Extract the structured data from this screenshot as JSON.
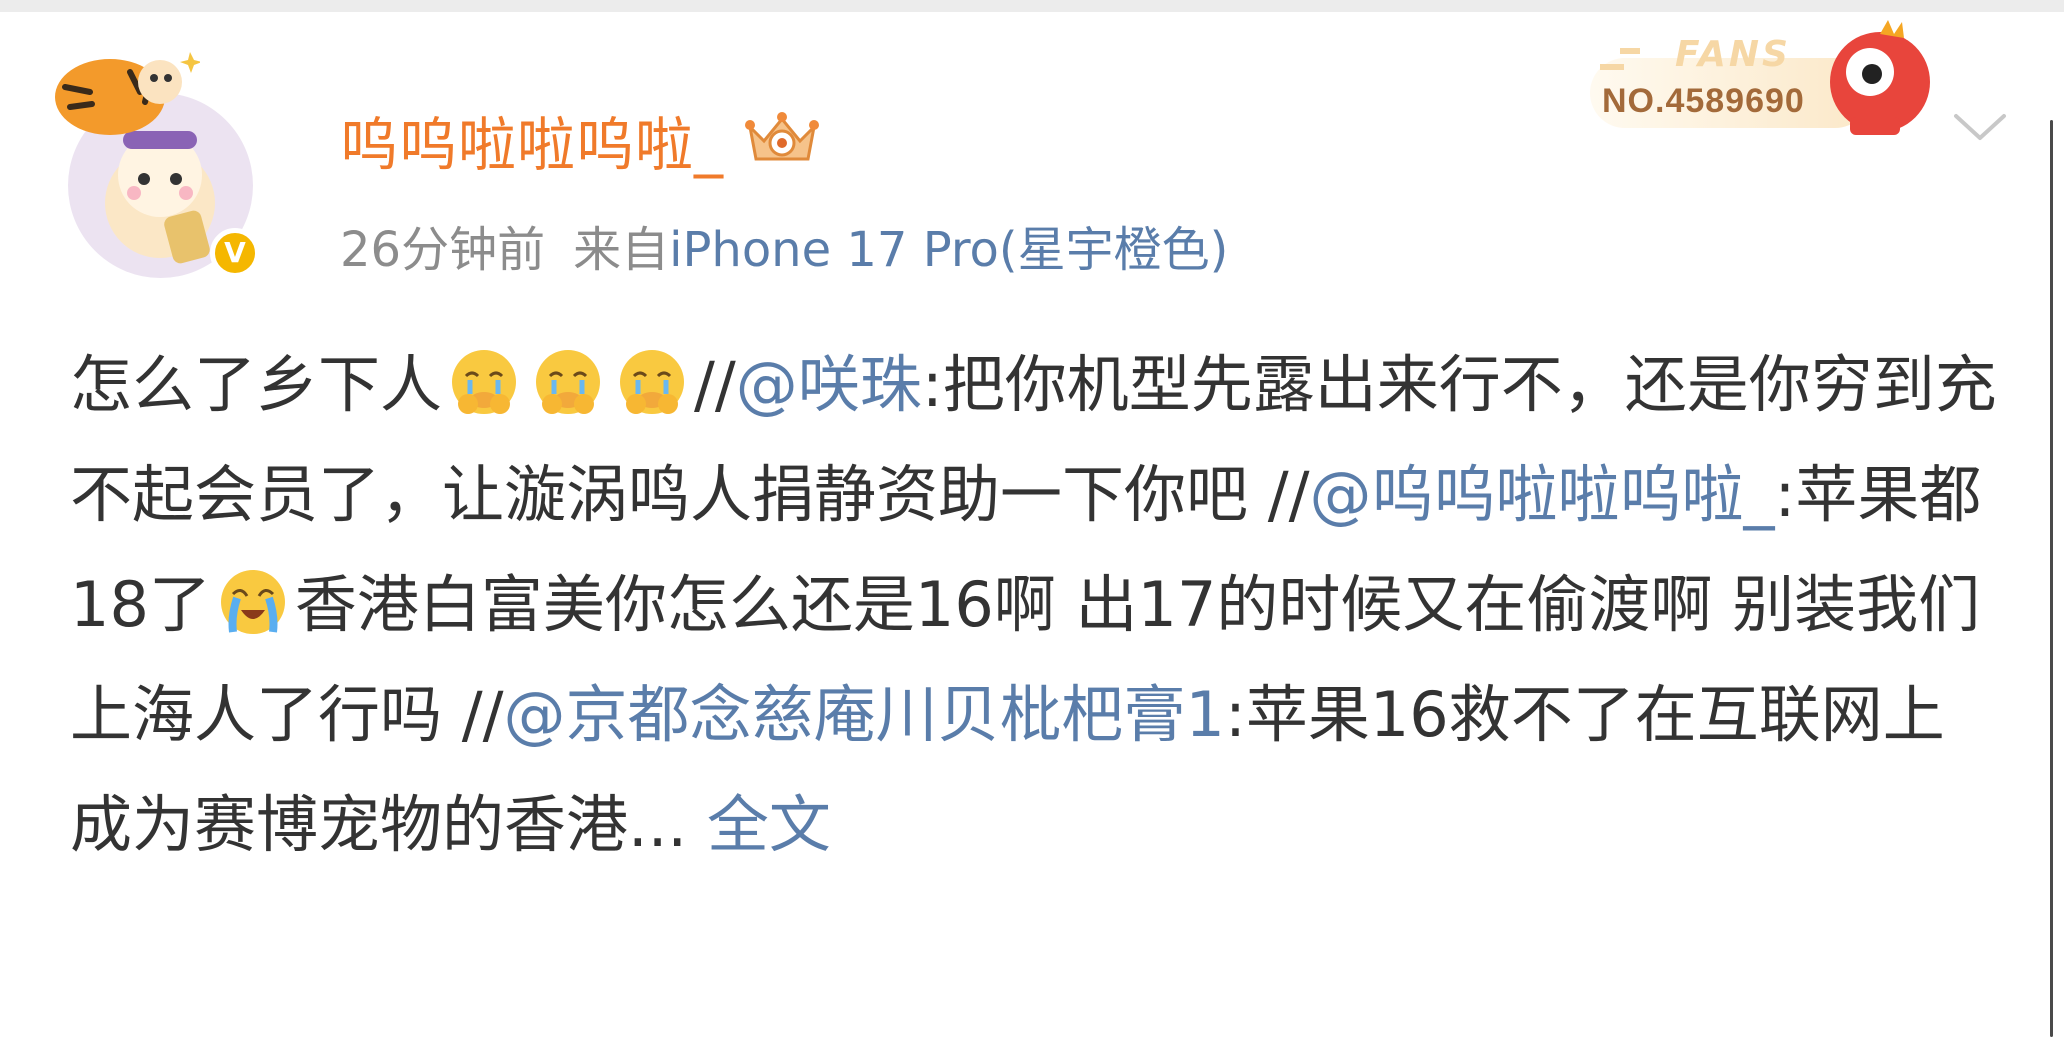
{
  "post": {
    "author": {
      "name": "呜呜啦啦呜啦_",
      "verified_badge": "V"
    },
    "fans_badge": {
      "label": "FANS",
      "number": "NO.4589690"
    },
    "meta": {
      "time": "26分钟前",
      "source_prefix": "来自",
      "device": "iPhone 17 Pro(星宇橙色)"
    },
    "content": {
      "seg1": "怎么了乡下人",
      "seg2": "//",
      "mention1": "@咲珠",
      "seg3": ":把你机型先露出来行不，还是你穷到充不起会员了，让漩涡鸣人捐静资助一下你吧 //",
      "mention2": "@呜呜啦啦呜啦_",
      "seg4": ":苹果都18了",
      "seg5": "香港白富美你怎么还是16啊 出17的时候又在偷渡啊 别装我们上海人了行吗 //",
      "mention3": "@京都念慈庵川贝枇杷膏1",
      "seg6": ":苹果16救不了在互联网上成为赛博宠物的香港...",
      "more": "全文"
    }
  },
  "icons": {
    "avatar": "avatar-tiger-cat",
    "crown": "crown-badge-icon",
    "dropdown": "chevron-down-icon",
    "emoji_tears": "crying-emoji-icon",
    "emoji_loud_cry": "loudly-crying-emoji-icon"
  },
  "colors": {
    "username": "#f07a2a",
    "link": "#5a7daa",
    "meta": "#8c8c8c",
    "text": "#333333",
    "verified": "#f5b700"
  }
}
